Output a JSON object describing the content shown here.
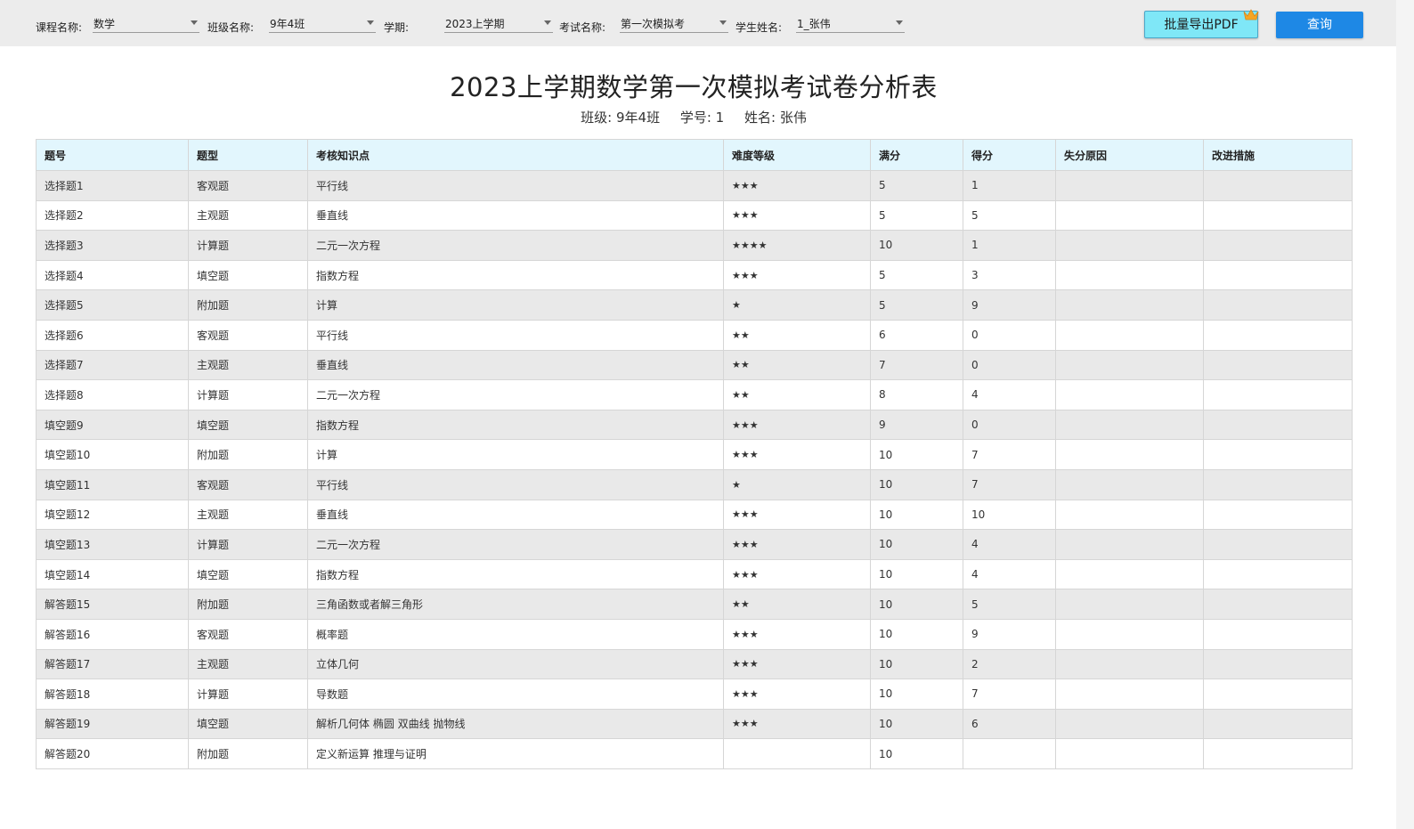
{
  "filters": {
    "course": {
      "label": "课程名称:",
      "value": "数学"
    },
    "class": {
      "label": "班级名称:",
      "value": "9年4班"
    },
    "term": {
      "label": "学期:",
      "value": "2023上学期"
    },
    "exam": {
      "label": "考试名称:",
      "value": "第一次模拟考"
    },
    "student": {
      "label": "学生姓名:",
      "value": "1_张伟"
    }
  },
  "buttons": {
    "export_pdf": "批量导出PDF",
    "query": "查询"
  },
  "report": {
    "title": "2023上学期数学第一次模拟考试卷分析表",
    "class_text": "班级: 9年4班",
    "student_no_text": "学号: 1",
    "name_text": "姓名: 张伟"
  },
  "table": {
    "headers": [
      "题号",
      "题型",
      "考核知识点",
      "难度等级",
      "满分",
      "得分",
      "失分原因",
      "改进措施"
    ],
    "rows": [
      [
        "选择题1",
        "客观题",
        "平行线",
        "★★★",
        "5",
        "1",
        "",
        ""
      ],
      [
        "选择题2",
        "主观题",
        "垂直线",
        "★★★",
        "5",
        "5",
        "",
        ""
      ],
      [
        "选择题3",
        "计算题",
        "二元一次方程",
        "★★★★",
        "10",
        "1",
        "",
        ""
      ],
      [
        "选择题4",
        "填空题",
        "指数方程",
        "★★★",
        "5",
        "3",
        "",
        ""
      ],
      [
        "选择题5",
        "附加题",
        "计算",
        "★",
        "5",
        "9",
        "",
        ""
      ],
      [
        "选择题6",
        "客观题",
        "平行线",
        "★★",
        "6",
        "0",
        "",
        ""
      ],
      [
        "选择题7",
        "主观题",
        "垂直线",
        "★★",
        "7",
        "0",
        "",
        ""
      ],
      [
        "选择题8",
        "计算题",
        "二元一次方程",
        "★★",
        "8",
        "4",
        "",
        ""
      ],
      [
        "填空题9",
        "填空题",
        "指数方程",
        "★★★",
        "9",
        "0",
        "",
        ""
      ],
      [
        "填空题10",
        "附加题",
        "计算",
        "★★★",
        "10",
        "7",
        "",
        ""
      ],
      [
        "填空题11",
        "客观题",
        "平行线",
        "★",
        "10",
        "7",
        "",
        ""
      ],
      [
        "填空题12",
        "主观题",
        "垂直线",
        "★★★",
        "10",
        "10",
        "",
        ""
      ],
      [
        "填空题13",
        "计算题",
        "二元一次方程",
        "★★★",
        "10",
        "4",
        "",
        ""
      ],
      [
        "填空题14",
        "填空题",
        "指数方程",
        "★★★",
        "10",
        "4",
        "",
        ""
      ],
      [
        "解答题15",
        "附加题",
        "三角函数或者解三角形",
        "★★",
        "10",
        "5",
        "",
        ""
      ],
      [
        "解答题16",
        "客观题",
        "概率题",
        "★★★",
        "10",
        "9",
        "",
        ""
      ],
      [
        "解答题17",
        "主观题",
        "立体几何",
        "★★★",
        "10",
        "2",
        "",
        ""
      ],
      [
        "解答题18",
        "计算题",
        "导数题",
        "★★★",
        "10",
        "7",
        "",
        ""
      ],
      [
        "解答题19",
        "填空题",
        "解析几何体 椭圆 双曲线 抛物线",
        "★★★",
        "10",
        "6",
        "",
        ""
      ],
      [
        "解答题20",
        "附加题",
        "定义新运算 推理与证明",
        "",
        "10",
        "",
        "",
        ""
      ]
    ]
  },
  "colors": {
    "accent": "#1e88e5",
    "pdf_button": "#7fe7f7",
    "header_bg": "#e2f6fd",
    "stripe": "#e9e9e9"
  },
  "icons": {
    "dropdown": "chevron-down-icon",
    "badge": "crown-badge-icon"
  }
}
